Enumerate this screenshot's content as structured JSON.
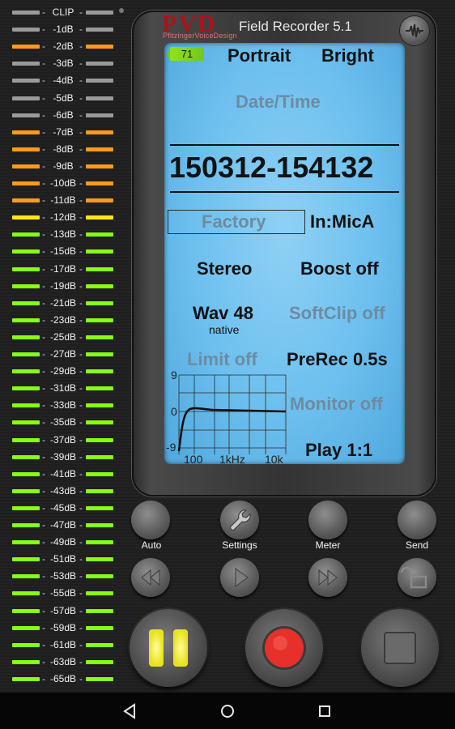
{
  "vu_meter": {
    "levels": [
      {
        "label": "CLIP",
        "color": "#9a9a9a"
      },
      {
        "label": "-1dB",
        "color": "#9a9a9a"
      },
      {
        "label": "-2dB",
        "color": "#ff9a1a"
      },
      {
        "label": "-3dB",
        "color": "#9a9a9a"
      },
      {
        "label": "-4dB",
        "color": "#9a9a9a"
      },
      {
        "label": "-5dB",
        "color": "#9a9a9a"
      },
      {
        "label": "-6dB",
        "color": "#9a9a9a"
      },
      {
        "label": "-7dB",
        "color": "#ff9a1a"
      },
      {
        "label": "-8dB",
        "color": "#ff9a1a"
      },
      {
        "label": "-9dB",
        "color": "#ff9a1a"
      },
      {
        "label": "-10dB",
        "color": "#ff9a1a"
      },
      {
        "label": "-11dB",
        "color": "#ff9a1a"
      },
      {
        "label": "-12dB",
        "color": "#ffe51a"
      },
      {
        "label": "-13dB",
        "color": "#86ff12"
      },
      {
        "label": "-15dB",
        "color": "#86ff12"
      },
      {
        "label": "-17dB",
        "color": "#86ff12"
      },
      {
        "label": "-19dB",
        "color": "#86ff12"
      },
      {
        "label": "-21dB",
        "color": "#86ff12"
      },
      {
        "label": "-23dB",
        "color": "#86ff12"
      },
      {
        "label": "-25dB",
        "color": "#86ff12"
      },
      {
        "label": "-27dB",
        "color": "#86ff12"
      },
      {
        "label": "-29dB",
        "color": "#86ff12"
      },
      {
        "label": "-31dB",
        "color": "#86ff12"
      },
      {
        "label": "-33dB",
        "color": "#86ff12"
      },
      {
        "label": "-35dB",
        "color": "#86ff12"
      },
      {
        "label": "-37dB",
        "color": "#86ff12"
      },
      {
        "label": "-39dB",
        "color": "#86ff12"
      },
      {
        "label": "-41dB",
        "color": "#86ff12"
      },
      {
        "label": "-43dB",
        "color": "#86ff12"
      },
      {
        "label": "-45dB",
        "color": "#86ff12"
      },
      {
        "label": "-47dB",
        "color": "#86ff12"
      },
      {
        "label": "-49dB",
        "color": "#86ff12"
      },
      {
        "label": "-51dB",
        "color": "#86ff12"
      },
      {
        "label": "-53dB",
        "color": "#86ff12"
      },
      {
        "label": "-55dB",
        "color": "#86ff12"
      },
      {
        "label": "-57dB",
        "color": "#86ff12"
      },
      {
        "label": "-59dB",
        "color": "#86ff12"
      },
      {
        "label": "-61dB",
        "color": "#86ff12"
      },
      {
        "label": "-63dB",
        "color": "#86ff12"
      },
      {
        "label": "-65dB",
        "color": "#86ff12"
      }
    ]
  },
  "device": {
    "logo": "PVD",
    "logo_subtitle": "PfitzingerVoiceDesign",
    "title": "Field Recorder 5.1",
    "waveform_button_icon": "waveform-icon"
  },
  "screen": {
    "battery": "71",
    "orientation": "Portrait",
    "brightness": "Bright",
    "date_time_label": "Date/Time",
    "filename": "150312-154132",
    "preset": "Factory",
    "input": "In:MicA",
    "channels": "Stereo",
    "boost": "Boost off",
    "format": "Wav 48",
    "format_sub": "native",
    "softclip": "SoftClip off",
    "limit": "Limit off",
    "prerec": "PreRec 0.5s",
    "monitor": "Monitor off",
    "play": "Play 1:1",
    "graph": {
      "y_labels": [
        "9",
        "0",
        "-9"
      ],
      "x_labels": [
        "100",
        "1kHz",
        "10k"
      ]
    }
  },
  "controls": {
    "auto_label": "Auto",
    "settings_label": "Settings",
    "meter_label": "Meter",
    "send_label": "Send"
  },
  "colors": {
    "pause": "#f2ec1a",
    "record": "#e8302a",
    "screen": "#6cbfee"
  }
}
